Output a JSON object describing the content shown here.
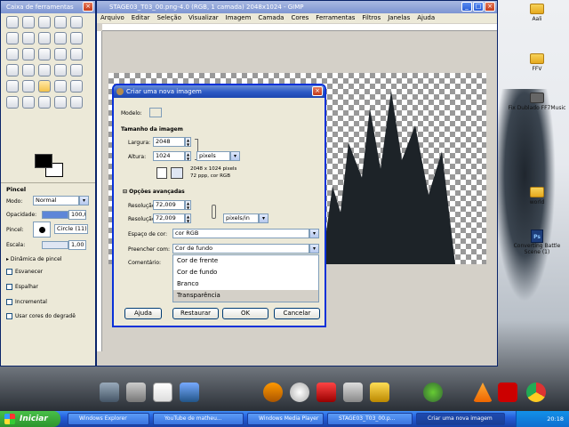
{
  "desktop": {
    "icons": [
      {
        "label": "Aali",
        "kind": "folder"
      },
      {
        "label": "FFV",
        "kind": "folder"
      },
      {
        "label": "Fix Dublado FF7Music",
        "kind": "app"
      },
      {
        "label": "world",
        "kind": "folder"
      },
      {
        "label": "Converting Battle Scene (1)",
        "kind": "psd"
      },
      {
        "label": "Lixeira",
        "kind": "recycle"
      }
    ]
  },
  "toolbox": {
    "title": "Caixa de ferramentas",
    "brush_section": "Pincel",
    "mode_label": "Modo:",
    "mode_value": "Normal",
    "opacity_label": "Opacidade:",
    "opacity_value": "100,0",
    "brush_label": "Pincel:",
    "brush_value": "Circle (11)",
    "scale_label": "Escala:",
    "scale_value": "1,00",
    "dynamics": "Dinâmica de pincel",
    "options": [
      "Esvanecer",
      "Espalhar",
      "Incremental",
      "Usar cores do degradê"
    ]
  },
  "gimp": {
    "title": "STAGE03_T03_00.png-4.0 (RGB, 1 camada) 2048x1024 - GIMP",
    "menu": [
      "Arquivo",
      "Editar",
      "Seleção",
      "Visualizar",
      "Imagem",
      "Camada",
      "Cores",
      "Ferramentas",
      "Filtros",
      "Janelas",
      "Ajuda"
    ]
  },
  "dialog": {
    "title": "Criar uma nova imagem",
    "model_label": "Modelo:",
    "size_section": "Tamanho da imagem",
    "width_label": "Largura:",
    "width_value": "2048",
    "height_label": "Altura:",
    "height_value": "1024",
    "unit": "pixels",
    "info_line1": "2048 x 1024 pixels",
    "info_line2": "72 ppp, cor RGB",
    "advanced_section": "Opções avançadas",
    "resx_label": "Resolução X:",
    "resx_value": "72,009",
    "resy_label": "Resolução Y:",
    "resy_value": "72,009",
    "res_unit": "pixels/in",
    "colorspace_label": "Espaço de cor:",
    "colorspace_value": "cor RGB",
    "fill_label": "Preencher com:",
    "fill_value": "Cor de fundo",
    "comment_label": "Comentário:",
    "fill_options": [
      "Cor de frente",
      "Cor de fundo",
      "Branco",
      "Transparência"
    ],
    "buttons": {
      "help": "Ajuda",
      "reset": "Restaurar",
      "ok": "OK",
      "cancel": "Cancelar"
    }
  },
  "taskbar": {
    "start": "Iniciar",
    "tasks": [
      "Windows Explorer",
      "YouTube de matheu...",
      "Windows Media Player",
      "STAGE03_T03_00.p...",
      "Criar uma nova imagem"
    ],
    "clock": "20:18"
  },
  "colors": {
    "xp_blue": "#245edb",
    "start_green": "#2e942e",
    "dialog_bg": "#ece9d8",
    "fill_highlight": "#d4d0c8"
  }
}
